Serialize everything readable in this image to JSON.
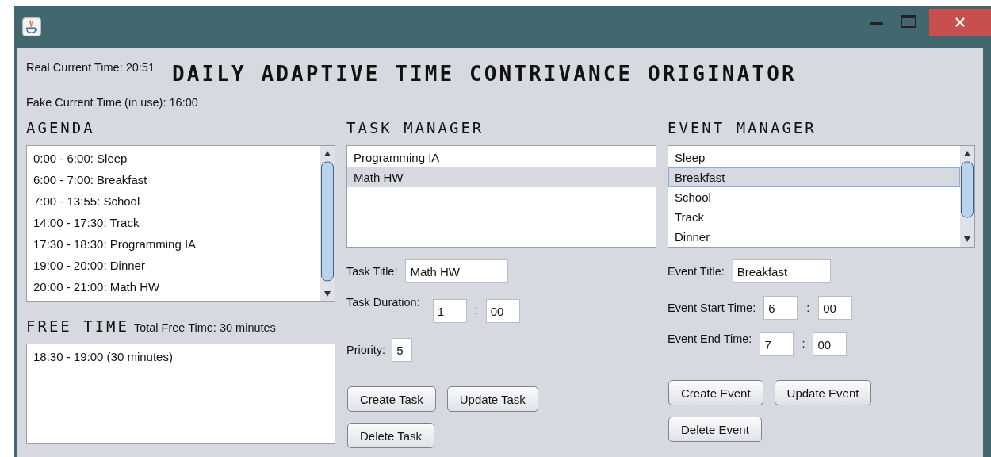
{
  "header": {
    "real_time": "Real Current Time: 20:51",
    "title": "DAILY ADAPTIVE TIME CONTRIVANCE ORIGINATOR",
    "fake_time": "Fake Current Time (in use): 16:00"
  },
  "agenda": {
    "heading": "AGENDA",
    "items": [
      {
        "label": "0:00 - 6:00: Sleep"
      },
      {
        "label": "6:00 - 7:00: Breakfast"
      },
      {
        "label": "7:00 - 13:55: School"
      },
      {
        "label": "14:00 - 17:30: Track"
      },
      {
        "label": "17:30 - 18:30: Programming IA"
      },
      {
        "label": "19:00 - 20:00: Dinner"
      },
      {
        "label": "20:00 - 21:00: Math HW"
      }
    ]
  },
  "free_time": {
    "heading": "FREE TIME",
    "total": "Total Free Time: 30 minutes",
    "items": [
      {
        "label": "18:30 - 19:00 (30 minutes)"
      }
    ]
  },
  "task_manager": {
    "heading": "TASK MANAGER",
    "items": [
      {
        "label": "Programming IA",
        "selected": false
      },
      {
        "label": "Math HW",
        "selected": true
      }
    ],
    "fields": [
      {
        "kind": "text",
        "label": "Task Title:",
        "value": "Math HW"
      },
      {
        "kind": "time",
        "label": "Task Duration:",
        "hours": "1",
        "separator": ":",
        "minutes": "00"
      },
      {
        "kind": "number",
        "label": "Priority:",
        "value": "5"
      }
    ],
    "buttons": [
      [
        "Create Task",
        "Update Task"
      ],
      [
        "Delete Task"
      ]
    ]
  },
  "event_manager": {
    "heading": "EVENT MANAGER",
    "items": [
      {
        "label": "Sleep",
        "selected": false
      },
      {
        "label": "Breakfast",
        "selected": true
      },
      {
        "label": "School",
        "selected": false
      },
      {
        "label": "Track",
        "selected": false
      },
      {
        "label": "Dinner",
        "selected": false
      }
    ],
    "fields": [
      {
        "kind": "text",
        "label": "Event Title:",
        "value": "Breakfast"
      },
      {
        "kind": "time",
        "label": "Event Start Time:",
        "hours": "6",
        "separator": ":",
        "minutes": "00"
      },
      {
        "kind": "time",
        "label": "Event End Time:",
        "hours": "7",
        "separator": ":",
        "minutes": "00"
      }
    ],
    "buttons": [
      [
        "Create Event",
        "Update Event"
      ],
      [
        "Delete Event"
      ]
    ]
  }
}
